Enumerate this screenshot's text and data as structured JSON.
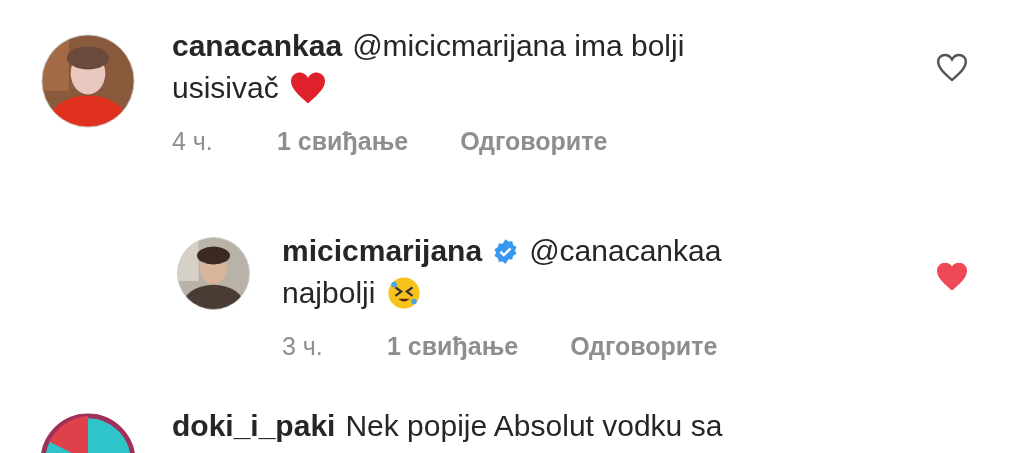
{
  "comments": [
    {
      "username": "canacankaa",
      "text": "@micicmarijana ima bolji",
      "text_line2": "usisivač",
      "emoji": {
        "kind": "heart"
      },
      "liked": false,
      "reply": false,
      "time": "4 ч.",
      "likes": "1 свиђање",
      "reply_label": "Одговорите"
    },
    {
      "username": "micicmarijana",
      "verified": true,
      "text": "@canacankaa",
      "text_line2": "najbolji",
      "emoji": {
        "kind": "laugh"
      },
      "liked": true,
      "reply": true,
      "time": "3 ч.",
      "likes": "1 свиђање",
      "reply_label": "Одговорите"
    }
  ],
  "next_comment": {
    "username": "doki_i_paki",
    "text": "Nek popije Absolut vodku sa"
  }
}
